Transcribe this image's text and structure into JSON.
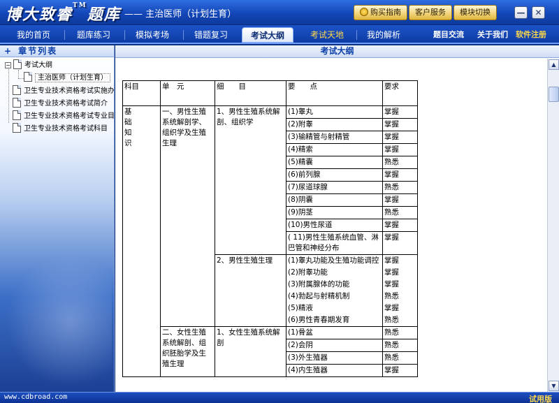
{
  "window": {
    "brand": "博大致睿",
    "brand_tm": "TM",
    "brand_suffix": "题库",
    "subtitle": "—— 主治医师（计划生育）",
    "buttons": [
      "购买指南",
      "客户服务",
      "模块切换"
    ],
    "minimize": "—",
    "close": "✕"
  },
  "nav": {
    "tabs": [
      "我的首页",
      "题库练习",
      "模拟考场",
      "错题复习",
      "考试大纲",
      "考试天地",
      "我的解析"
    ],
    "active_index": 4,
    "gold_index": 5,
    "right_links": [
      "题目交流",
      "关于我们",
      "软件注册"
    ]
  },
  "sidebar": {
    "title": "章节列表",
    "tree": [
      {
        "label": "考试大纲",
        "level": 0,
        "expanded": true
      },
      {
        "label": "主治医师（计划生育）",
        "level": 1,
        "selected": true
      },
      {
        "label": "卫生专业技术资格考试实施办",
        "level": 0
      },
      {
        "label": "卫生专业技术资格考试简介",
        "level": 0
      },
      {
        "label": "卫生专业技术资格考试专业目",
        "level": 0
      },
      {
        "label": "卫生专业技术资格考试科目",
        "level": 0
      }
    ]
  },
  "main": {
    "title": "考试大纲",
    "table": {
      "headers": [
        "科目",
        "单　元",
        "细　　目",
        "要　　点",
        "要求"
      ],
      "subject": [
        "基",
        "础",
        "知",
        "识"
      ],
      "units": [
        {
          "name": "一、男性生殖系统解剖学、组织学及生殖生理",
          "details": [
            {
              "name": "1、男性生殖系统解剖、组织学",
              "points": [
                {
                  "text": "(1)睾丸",
                  "req": "掌握"
                },
                {
                  "text": "(2)附睾",
                  "req": "掌握"
                },
                {
                  "text": "(3)输精管与射精管",
                  "req": "掌握"
                },
                {
                  "text": "(4)精索",
                  "req": "掌握"
                },
                {
                  "text": "(5)精囊",
                  "req": "熟悉"
                },
                {
                  "text": "(6)前列腺",
                  "req": "掌握"
                },
                {
                  "text": "(7)尿道球腺",
                  "req": "熟悉"
                },
                {
                  "text": "(8)阴囊",
                  "req": "掌握"
                },
                {
                  "text": "(9)阴茎",
                  "req": "熟悉"
                },
                {
                  "text": "(10)男性尿道",
                  "req": "掌握"
                },
                {
                  "text": "( 11)男性生殖系统血管、淋巴管和神经分布",
                  "req": "掌握"
                }
              ]
            },
            {
              "name": "2、男性生殖生理",
              "points": [
                {
                  "text": "(1)睾丸功能及生殖功能调控",
                  "req": "掌握"
                },
                {
                  "text": "(2)附睾功能",
                  "req": "掌握"
                },
                {
                  "text": "(3)附属腺体的功能",
                  "req": "掌握"
                },
                {
                  "text": "(4)勃起与射精机制",
                  "req": "熟悉"
                },
                {
                  "text": "(5)精液",
                  "req": "掌握"
                },
                {
                  "text": "(6)男性青春期发育",
                  "req": "熟悉"
                }
              ]
            }
          ]
        },
        {
          "name": "二、女性生殖系统解剖、组织胚胎学及生殖生理",
          "details": [
            {
              "name": "1、女性生殖系统解剖",
              "points": [
                {
                  "text": "(1)骨盆",
                  "req": "熟悉"
                },
                {
                  "text": "(2)会阴",
                  "req": "熟悉"
                },
                {
                  "text": "(3)外生殖器",
                  "req": "熟悉"
                },
                {
                  "text": "(4)内生殖器",
                  "req": "掌握"
                }
              ]
            }
          ]
        }
      ]
    }
  },
  "status": {
    "left": "www.cdbroad.com",
    "right": "试用版"
  },
  "colors": {
    "titlebar": "#1346b8",
    "accent_gold": "#ffd94a",
    "sidebar_text": "#0a3ea8"
  }
}
